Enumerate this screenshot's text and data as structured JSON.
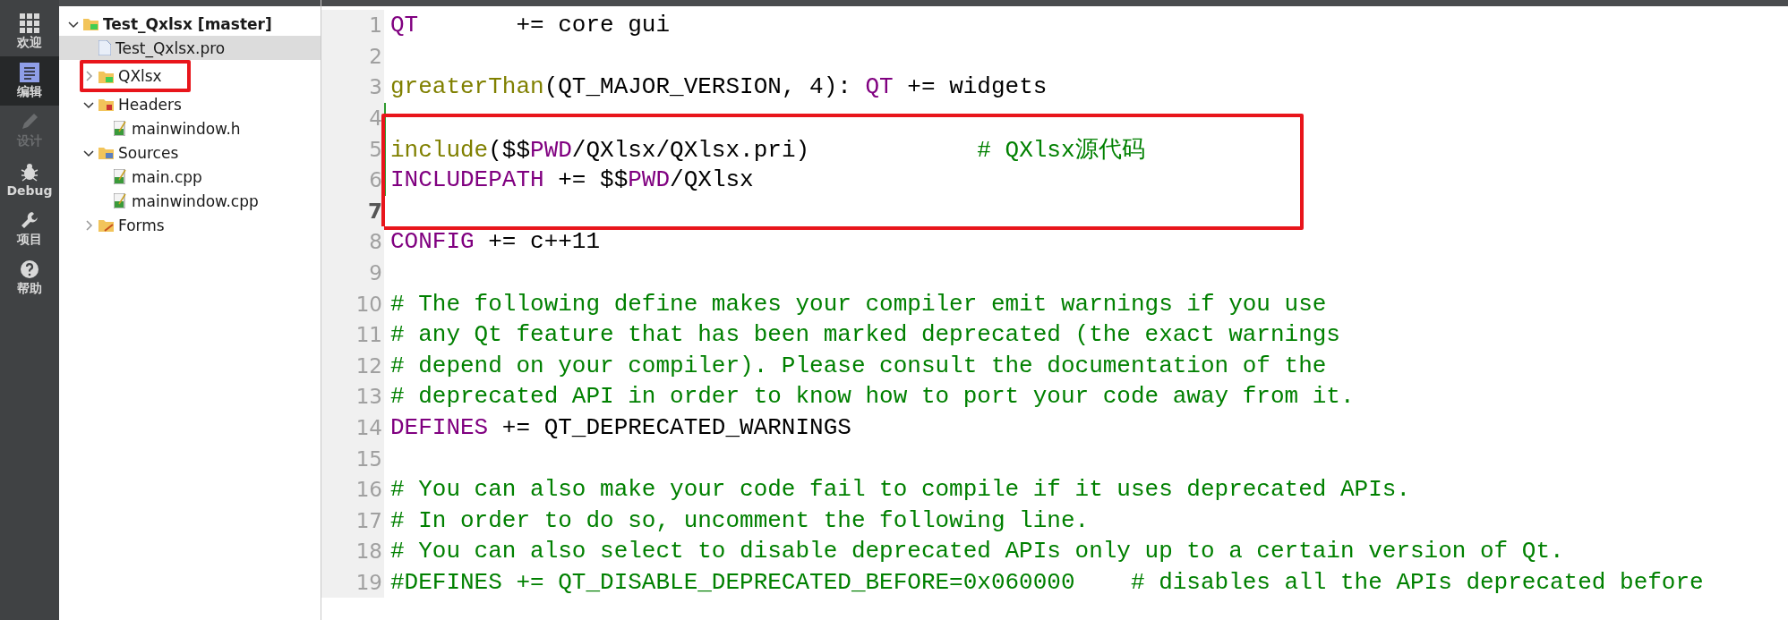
{
  "modes": [
    {
      "label": "欢迎",
      "selected": false,
      "disabled": false
    },
    {
      "label": "编辑",
      "selected": true,
      "disabled": false
    },
    {
      "label": "设计",
      "selected": false,
      "disabled": true
    },
    {
      "label": "Debug",
      "selected": false,
      "disabled": false
    },
    {
      "label": "项目",
      "selected": false,
      "disabled": false
    },
    {
      "label": "帮助",
      "selected": false,
      "disabled": false
    }
  ],
  "project_tree": [
    {
      "label": "Test_Qxlsx [master]",
      "kind": "project",
      "expanded": true,
      "selected": false,
      "boxed": false,
      "children": [
        {
          "label": "Test_Qxlsx.pro",
          "kind": "profile",
          "selected": true,
          "boxed": false
        },
        {
          "label": "QXlsx",
          "kind": "project",
          "expanded": false,
          "selected": false,
          "boxed": true
        },
        {
          "label": "Headers",
          "kind": "headers",
          "expanded": true,
          "selected": false,
          "boxed": false,
          "children": [
            {
              "label": "mainwindow.h",
              "kind": "source",
              "selected": false,
              "boxed": false
            }
          ]
        },
        {
          "label": "Sources",
          "kind": "sources",
          "expanded": true,
          "selected": false,
          "boxed": false,
          "children": [
            {
              "label": "main.cpp",
              "kind": "source",
              "selected": false,
              "boxed": false
            },
            {
              "label": "mainwindow.cpp",
              "kind": "source",
              "selected": false,
              "boxed": false
            }
          ]
        },
        {
          "label": "Forms",
          "kind": "forms",
          "expanded": false,
          "selected": false,
          "boxed": false
        }
      ]
    }
  ],
  "editor": {
    "lines": [
      {
        "number": "1",
        "modified": false,
        "current": false,
        "boxed": false,
        "tokens": [
          {
            "kind": "var",
            "text": "QT"
          },
          {
            "kind": "plain",
            "text": "       += core gui"
          }
        ]
      },
      {
        "number": "2",
        "modified": false,
        "current": false,
        "boxed": false
      },
      {
        "number": "3",
        "modified": false,
        "current": false,
        "boxed": false,
        "tokens": [
          {
            "kind": "func",
            "text": "greaterThan"
          },
          {
            "kind": "plain",
            "text": "(QT_MAJOR_VERSION, 4): "
          },
          {
            "kind": "var",
            "text": "QT"
          },
          {
            "kind": "plain",
            "text": " += widgets"
          }
        ]
      },
      {
        "number": "4",
        "modified": true,
        "current": false,
        "boxed": false
      },
      {
        "number": "5",
        "modified": true,
        "current": false,
        "boxed": true,
        "tokens": [
          {
            "kind": "func",
            "text": "include"
          },
          {
            "kind": "plain",
            "text": "($$"
          },
          {
            "kind": "var",
            "text": "PWD"
          },
          {
            "kind": "plain",
            "text": "/QXlsx/QXlsx.pri)            "
          },
          {
            "kind": "comment",
            "text": "# QXlsx源代码"
          }
        ]
      },
      {
        "number": "6",
        "modified": true,
        "current": false,
        "boxed": true,
        "tokens": [
          {
            "kind": "var",
            "text": "INCLUDEPATH"
          },
          {
            "kind": "plain",
            "text": " += $$"
          },
          {
            "kind": "var",
            "text": "PWD"
          },
          {
            "kind": "plain",
            "text": "/QXlsx"
          }
        ]
      },
      {
        "number": "7",
        "modified": false,
        "current": true,
        "boxed": true
      },
      {
        "number": "8",
        "modified": false,
        "current": false,
        "boxed": false,
        "tokens": [
          {
            "kind": "var",
            "text": "CONFIG"
          },
          {
            "kind": "plain",
            "text": " += c++11"
          }
        ]
      },
      {
        "number": "9",
        "modified": false,
        "current": false,
        "boxed": false
      },
      {
        "number": "10",
        "modified": false,
        "current": false,
        "boxed": false,
        "tokens": [
          {
            "kind": "comment",
            "text": "# The following define makes your compiler emit warnings if you use"
          }
        ]
      },
      {
        "number": "11",
        "modified": false,
        "current": false,
        "boxed": false,
        "tokens": [
          {
            "kind": "comment",
            "text": "# any Qt feature that has been marked deprecated (the exact warnings"
          }
        ]
      },
      {
        "number": "12",
        "modified": false,
        "current": false,
        "boxed": false,
        "tokens": [
          {
            "kind": "comment",
            "text": "# depend on your compiler). Please consult the documentation of the"
          }
        ]
      },
      {
        "number": "13",
        "modified": false,
        "current": false,
        "boxed": false,
        "tokens": [
          {
            "kind": "comment",
            "text": "# deprecated API in order to know how to port your code away from it."
          }
        ]
      },
      {
        "number": "14",
        "modified": false,
        "current": false,
        "boxed": false,
        "tokens": [
          {
            "kind": "var",
            "text": "DEFINES"
          },
          {
            "kind": "plain",
            "text": " += QT_DEPRECATED_WARNINGS"
          }
        ]
      },
      {
        "number": "15",
        "modified": false,
        "current": false,
        "boxed": false
      },
      {
        "number": "16",
        "modified": false,
        "current": false,
        "boxed": false,
        "tokens": [
          {
            "kind": "comment",
            "text": "# You can also make your code fail to compile if it uses deprecated APIs."
          }
        ]
      },
      {
        "number": "17",
        "modified": false,
        "current": false,
        "boxed": false,
        "tokens": [
          {
            "kind": "comment",
            "text": "# In order to do so, uncomment the following line."
          }
        ]
      },
      {
        "number": "18",
        "modified": false,
        "current": false,
        "boxed": false,
        "tokens": [
          {
            "kind": "comment",
            "text": "# You can also select to disable deprecated APIs only up to a certain version of Qt."
          }
        ]
      },
      {
        "number": "19",
        "modified": false,
        "current": false,
        "boxed": false,
        "tokens": [
          {
            "kind": "comment",
            "text": "#DEFINES += QT_DISABLE_DEPRECATED_BEFORE=0x060000    # disables all the APIs deprecated before"
          }
        ]
      }
    ]
  }
}
